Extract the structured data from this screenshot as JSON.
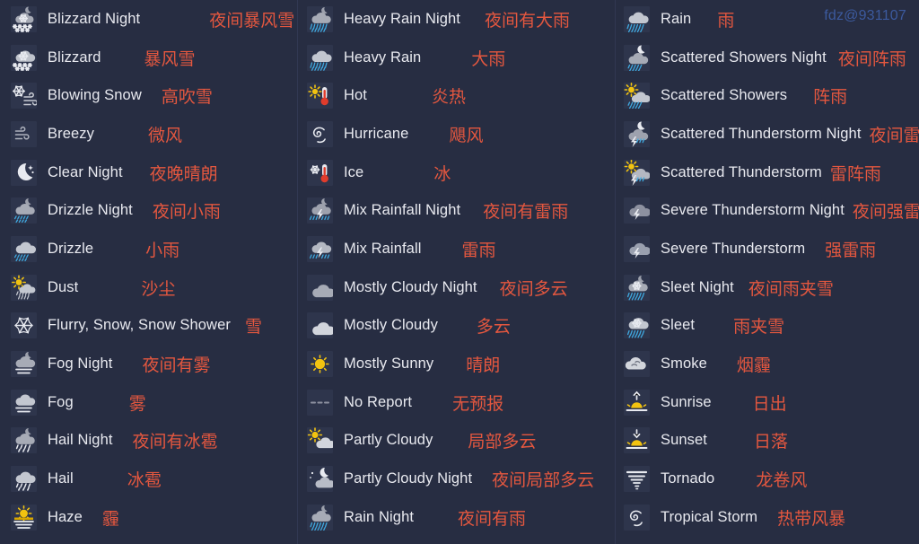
{
  "watermark": "fdz@931107",
  "colors": {
    "background": "#272D42",
    "icon_tile": "#2E354C",
    "english_label": "#E9EAF0",
    "chinese_label": "#E4573F",
    "watermark": "#3C5A9E",
    "divider": "#313852"
  },
  "columns": [
    {
      "rows": [
        {
          "icon": "blizzard-night-icon",
          "en": "Blizzard Night",
          "zh": "夜间暴风雪",
          "gap": 77
        },
        {
          "icon": "blizzard-icon",
          "en": "Blizzard",
          "zh": "暴风雪",
          "gap": 48
        },
        {
          "icon": "blowing-snow-icon",
          "en": "Blowing Snow",
          "zh": "高吹雪",
          "gap": 22
        },
        {
          "icon": "breezy-icon",
          "en": "Breezy",
          "zh": "微风",
          "gap": 60
        },
        {
          "icon": "clear-night-icon",
          "en": "Clear Night",
          "zh": "夜晚晴朗",
          "gap": 30
        },
        {
          "icon": "drizzle-night-icon",
          "en": "Drizzle Night",
          "zh": "夜间小雨",
          "gap": 22
        },
        {
          "icon": "drizzle-icon",
          "en": "Drizzle",
          "zh": "小雨",
          "gap": 58
        },
        {
          "icon": "dust-icon",
          "en": "Dust",
          "zh": "沙尘",
          "gap": 70
        },
        {
          "icon": "flurry-snow-shower-icon",
          "en": "Flurry, Snow, Snow Shower",
          "zh": "雪",
          "gap": 16
        },
        {
          "icon": "fog-night-icon",
          "en": "Fog Night",
          "zh": "夜间有雾",
          "gap": 33
        },
        {
          "icon": "fog-icon",
          "en": "Fog",
          "zh": "雾",
          "gap": 62
        },
        {
          "icon": "hail-night-icon",
          "en": "Hail Night",
          "zh": "夜间有冰雹",
          "gap": 22
        },
        {
          "icon": "hail-icon",
          "en": "Hail",
          "zh": "冰雹",
          "gap": 60
        },
        {
          "icon": "haze-icon",
          "en": "Haze",
          "zh": "霾",
          "gap": 22
        }
      ]
    },
    {
      "rows": [
        {
          "icon": "heavy-rain-night-icon",
          "en": "Heavy Rain Night",
          "zh": "夜间有大雨",
          "gap": 27
        },
        {
          "icon": "heavy-rain-icon",
          "en": "Heavy Rain",
          "zh": "大雨",
          "gap": 56
        },
        {
          "icon": "hot-icon",
          "en": "Hot",
          "zh": "炎热",
          "gap": 72
        },
        {
          "icon": "hurricane-icon",
          "en": "Hurricane",
          "zh": "飓风",
          "gap": 45
        },
        {
          "icon": "ice-icon",
          "en": "Ice",
          "zh": "冰",
          "gap": 78
        },
        {
          "icon": "mix-rainfall-night-icon",
          "en": "Mix Rainfall Night",
          "zh": "夜间有雷雨",
          "gap": 25
        },
        {
          "icon": "mix-rainfall-icon",
          "en": "Mix Rainfall",
          "zh": "雷雨",
          "gap": 45
        },
        {
          "icon": "mostly-cloudy-night-icon",
          "en": "Mostly Cloudy Night",
          "zh": "夜间多云",
          "gap": 25
        },
        {
          "icon": "mostly-cloudy-icon",
          "en": "Mostly Cloudy",
          "zh": "多云",
          "gap": 43
        },
        {
          "icon": "mostly-sunny-icon",
          "en": "Mostly Sunny",
          "zh": "晴朗",
          "gap": 36
        },
        {
          "icon": "no-report-icon",
          "en": "No Report",
          "zh": "无预报",
          "gap": 45
        },
        {
          "icon": "partly-cloudy-icon",
          "en": "Partly Cloudy",
          "zh": "局部多云",
          "gap": 39
        },
        {
          "icon": "partly-cloudy-night-icon",
          "en": "Partly Cloudy Night",
          "zh": "夜间局部多云",
          "gap": 22
        },
        {
          "icon": "rain-night-icon",
          "en": "Rain Night",
          "zh": "夜间有雨",
          "gap": 49
        }
      ]
    },
    {
      "rows": [
        {
          "icon": "rain-icon",
          "en": "Rain",
          "zh": "雨",
          "gap": 29
        },
        {
          "icon": "scattered-showers-night-icon",
          "en": "Scattered Showers Night",
          "zh": "夜间阵雨",
          "gap": 13
        },
        {
          "icon": "scattered-showers-icon",
          "en": "Scattered Showers",
          "zh": "阵雨",
          "gap": 29
        },
        {
          "icon": "scattered-thunderstorm-night-icon",
          "en": "Scattered Thunderstorm Night",
          "zh": "夜间雷阵雨",
          "gap": 9
        },
        {
          "icon": "scattered-thunderstorm-icon",
          "en": "Scattered Thunderstorm",
          "zh": "雷阵雨",
          "gap": 9
        },
        {
          "icon": "severe-thunderstorm-night-icon",
          "en": "Severe Thunderstorm Night",
          "zh": "夜间强雷雨",
          "gap": 9
        },
        {
          "icon": "severe-thunderstorm-icon",
          "en": "Severe Thunderstorm",
          "zh": "强雷雨",
          "gap": 22
        },
        {
          "icon": "sleet-night-icon",
          "en": "Sleet Night",
          "zh": "夜间雨夹雪",
          "gap": 16
        },
        {
          "icon": "sleet-icon",
          "en": "Sleet",
          "zh": "雨夹雪",
          "gap": 43
        },
        {
          "icon": "smoke-icon",
          "en": "Smoke",
          "zh": "烟霾",
          "gap": 33
        },
        {
          "icon": "sunrise-icon",
          "en": "Sunrise",
          "zh": "日出",
          "gap": 46
        },
        {
          "icon": "sunset-icon",
          "en": "Sunset",
          "zh": "日落",
          "gap": 52
        },
        {
          "icon": "tornado-icon",
          "en": "Tornado",
          "zh": "龙卷风",
          "gap": 46
        },
        {
          "icon": "tropical-storm-icon",
          "en": "Tropical Storm",
          "zh": "热带风暴",
          "gap": 22
        }
      ]
    }
  ]
}
